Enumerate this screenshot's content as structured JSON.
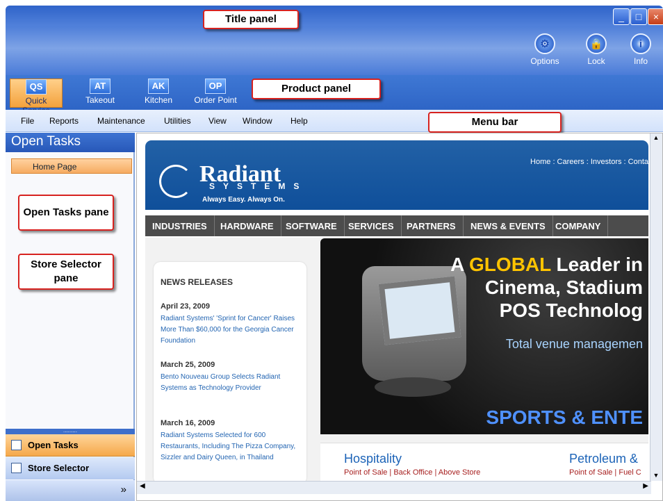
{
  "window": {
    "min_glyph": "_",
    "max_glyph": "□",
    "close_glyph": "×"
  },
  "toolbar": {
    "options_label": "Options",
    "lock_label": "Lock",
    "info_label": "Info",
    "info_glyph": "i"
  },
  "product_panel": {
    "items": [
      {
        "abbr": "QS",
        "label": "Quick Service"
      },
      {
        "abbr": "AT",
        "label": "Takeout"
      },
      {
        "abbr": "AK",
        "label": "Kitchen"
      },
      {
        "abbr": "OP",
        "label": "Order Point"
      }
    ]
  },
  "menu": {
    "items": [
      "File",
      "Reports",
      "Maintenance",
      "Utilities",
      "View",
      "Window",
      "Help"
    ]
  },
  "left_pane": {
    "header": "Open Tasks",
    "home_tab": "Home Page",
    "bottom_buttons": [
      "Open Tasks",
      "Store Selector"
    ],
    "footer_glyph": "»"
  },
  "callouts": {
    "title_panel": "Title panel",
    "product_panel": "Product panel",
    "menu_bar": "Menu bar",
    "open_tasks_pane": "Open Tasks pane",
    "store_selector_pane": "Store Selector pane"
  },
  "browser": {
    "top_links": "Home : Careers : Investors : Conta",
    "logo": "Radiant",
    "logo_sub": "SYSTEMS",
    "tagline": "Always Easy. Always On.",
    "nav_tabs": [
      "INDUSTRIES",
      "HARDWARE",
      "SOFTWARE",
      "SERVICES",
      "PARTNERS",
      "NEWS & EVENTS",
      "COMPANY"
    ],
    "news_heading": "NEWS RELEASES",
    "news": [
      {
        "date": "April 23, 2009",
        "text": "Radiant Systems' 'Sprint for Cancer' Raises More Than $60,000 for the Georgia Cancer Foundation"
      },
      {
        "date": "March 25, 2009",
        "text": "Bento Nouveau Group Selects Radiant Systems as Technology Provider"
      },
      {
        "date": "March 16, 2009",
        "text": "Radiant Systems Selected for 600 Restaurants, Including The Pizza Company, Sizzler and Dairy Queen, in Thailand"
      }
    ],
    "hero": {
      "line1_a": "A ",
      "line1_gold": "GLOBAL",
      "line1_b": " Leader in",
      "line2": "Cinema, Stadium",
      "line3": "POS Technolog",
      "sub": "Total venue managemen",
      "bottom": "SPORTS & ENTE"
    },
    "bottom_left_title": "Hospitality",
    "bottom_left_links": "Point of Sale | Back Office | Above Store",
    "bottom_right_title": "Petroleum &",
    "bottom_right_links": "Point of Sale | Fuel C"
  }
}
